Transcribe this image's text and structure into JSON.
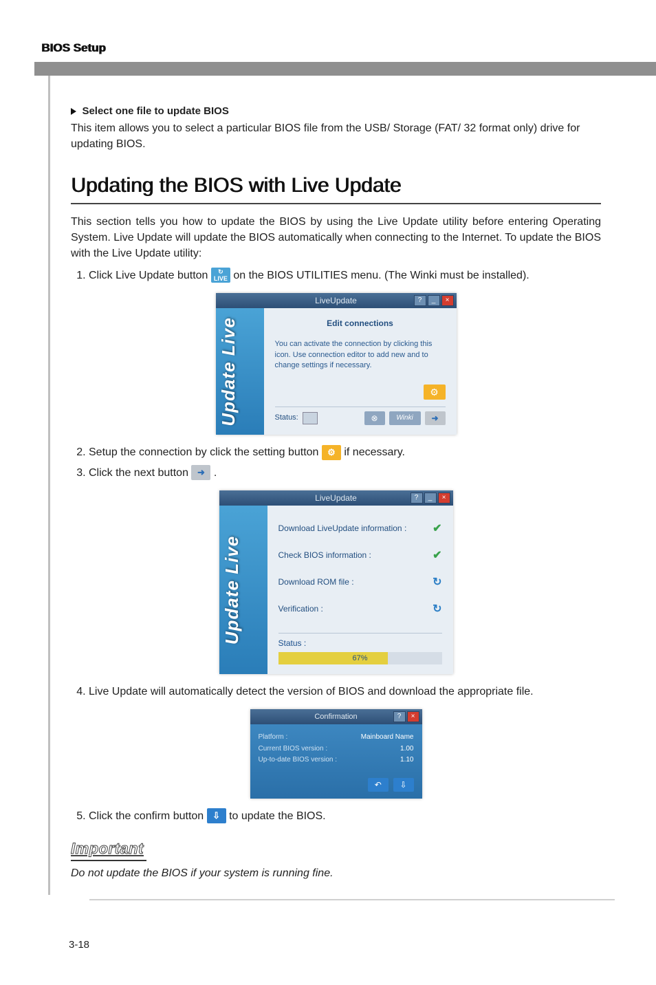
{
  "header": {
    "title": "BIOS Setup"
  },
  "sub": {
    "title": "Select one file to update BIOS",
    "body": "This item allows you to select a particular BIOS file from the USB/ Storage (FAT/ 32 format only) drive for updating BIOS."
  },
  "section": {
    "title": "Updating the BIOS with Live Update",
    "intro": "This section tells you how to update the BIOS by using the Live Update utility before entering Operating System. Live Update will update the BIOS automatically when connecting to the Internet. To update the BIOS with the Live Update utility:"
  },
  "steps": {
    "s1a": "Click Live Update button ",
    "s1b": " on the BIOS UTILITIES menu. (The Winki must be installed).",
    "s2a": "Setup the connection by click the setting button ",
    "s2b": " if necessary.",
    "s3a": "Click the next button ",
    "s3b": " .",
    "s4": "Live Update will automatically detect the version of BIOS and download the appropriate file.",
    "s5a": "Click the confirm button ",
    "s5b": " to update the BIOS."
  },
  "shot1": {
    "title": "LiveUpdate",
    "pane_title": "Edit connections",
    "pane_text": "You can activate the connection by clicking this icon. Use connection editor to add new and to change settings if necessary.",
    "status_label": "Status:",
    "winki": "Winki",
    "logo": "Update Live"
  },
  "shot2": {
    "title": "LiveUpdate",
    "r1": "Download LiveUpdate information :",
    "r2": "Check BIOS information :",
    "r3": "Download ROM file :",
    "r4": "Verification :",
    "status_label": "Status :",
    "progress": "67%",
    "logo": "Update Live"
  },
  "shot3": {
    "title": "Confirmation",
    "platform_l": "Platform :",
    "platform_v": "Mainboard Name",
    "cur_l": "Current BIOS version :",
    "cur_v": "1.00",
    "up_l": "Up-to-date BIOS version :",
    "up_v": "1.10"
  },
  "important": {
    "label": "Important",
    "note": "Do not update the BIOS if your system is running fine."
  },
  "footer": {
    "page": "3-18"
  }
}
